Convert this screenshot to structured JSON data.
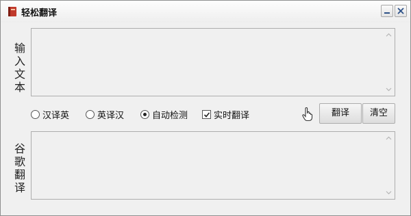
{
  "window": {
    "title": "轻松翻译",
    "icons": {
      "app": "book-icon",
      "minimize": "minimize-icon",
      "close": "close-icon"
    }
  },
  "input_section": {
    "label_chars": [
      "输",
      "入",
      "文",
      "本"
    ],
    "value": ""
  },
  "options": {
    "radios": [
      {
        "label": "汉译英",
        "checked": false
      },
      {
        "label": "英译汉",
        "checked": false
      },
      {
        "label": "自动检测",
        "checked": true
      }
    ],
    "realtime": {
      "label": "实时翻译",
      "checked": true
    }
  },
  "buttons": {
    "translate": "翻译",
    "clear": "清空"
  },
  "output_section": {
    "label_chars": [
      "谷",
      "歌",
      "翻",
      "译"
    ],
    "value": ""
  },
  "colors": {
    "window_bg": "#f0f0f0",
    "border": "#adadad",
    "app_icon": "#c0392b"
  }
}
